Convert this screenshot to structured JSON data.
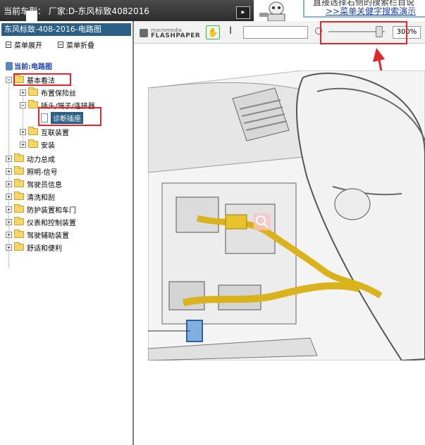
{
  "topbar": {
    "car_model": "当前车型： 厂家:D-东风标致4082016",
    "nav_button": "▸"
  },
  "ad": {
    "line1": "直接选择右侧的搜索栏目说",
    "link": ">>菜单关健字搜索演示"
  },
  "sidebar": {
    "title": "东风标致-408-2016-电路图",
    "expand_label": "菜单展开",
    "collapse_label": "菜单折叠",
    "current_label": "当前:电路图",
    "tree": {
      "root": "基本看法",
      "children": [
        {
          "label": "布置保险丝"
        },
        {
          "label": "插头/端子/连接器",
          "children": [
            {
              "label": "诊断插座"
            }
          ]
        },
        {
          "label": "互联装置"
        },
        {
          "label": "安装"
        }
      ],
      "top_level": [
        "动力总成",
        "照明-信号",
        "驾驶员信息",
        "清洗和刮",
        "防护装置和车门",
        "仪表和控制装置",
        "驾驶辅助装置",
        "舒适和便利"
      ]
    }
  },
  "viewer": {
    "brand": "macromedia",
    "product": "FLASHPAPER",
    "zoom": "300%",
    "zoom_slider_fraction": 0.9
  },
  "colors": {
    "sidebar_title_bg": "#2a5f86",
    "highlight": "#e4252a",
    "link": "#1a3fb5"
  }
}
